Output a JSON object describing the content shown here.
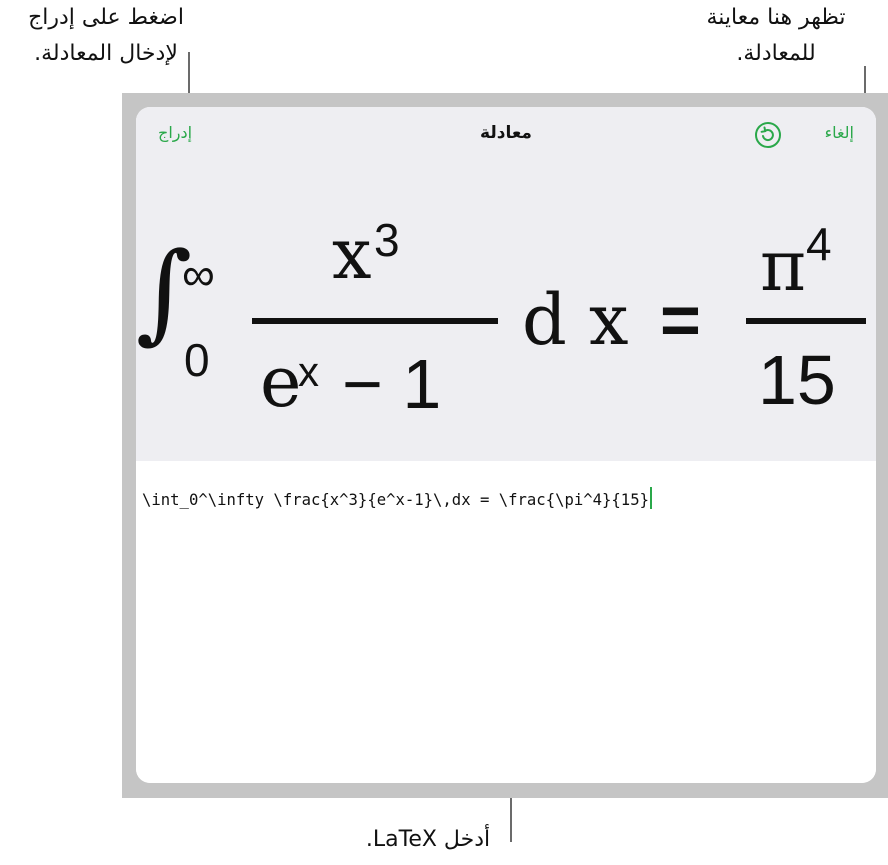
{
  "callouts": {
    "insert_line1": "اضغط على إدراج",
    "insert_line2": "لإدخال المعادلة.",
    "preview_line1": "تظهر هنا معاينة",
    "preview_line2": "للمعادلة.",
    "latex": "أدخل LaTeX."
  },
  "navbar": {
    "insert_label": "إدراج",
    "title": "معادلة",
    "cancel_label": "إلغاء",
    "refresh_icon": "refresh-icon"
  },
  "equation": {
    "integral": "∫",
    "upper_limit": "∞",
    "lower_limit": "0",
    "numerator_base": "x",
    "numerator_exp": "3",
    "denominator_base": "e",
    "denominator_exp": "x",
    "denominator_rest": "− 1",
    "differential": "d x",
    "equals": "=",
    "rhs_numerator_base": "π",
    "rhs_numerator_exp": "4",
    "rhs_denominator": "15"
  },
  "editor": {
    "latex_source": "\\int_0^\\infty \\frac{x^3}{e^x-1}\\,dx = \\frac{\\pi^4}{15}"
  },
  "colors": {
    "accent": "#2aa84a",
    "frame": "#c5c5c5",
    "preview_bg": "#eeeef2"
  }
}
